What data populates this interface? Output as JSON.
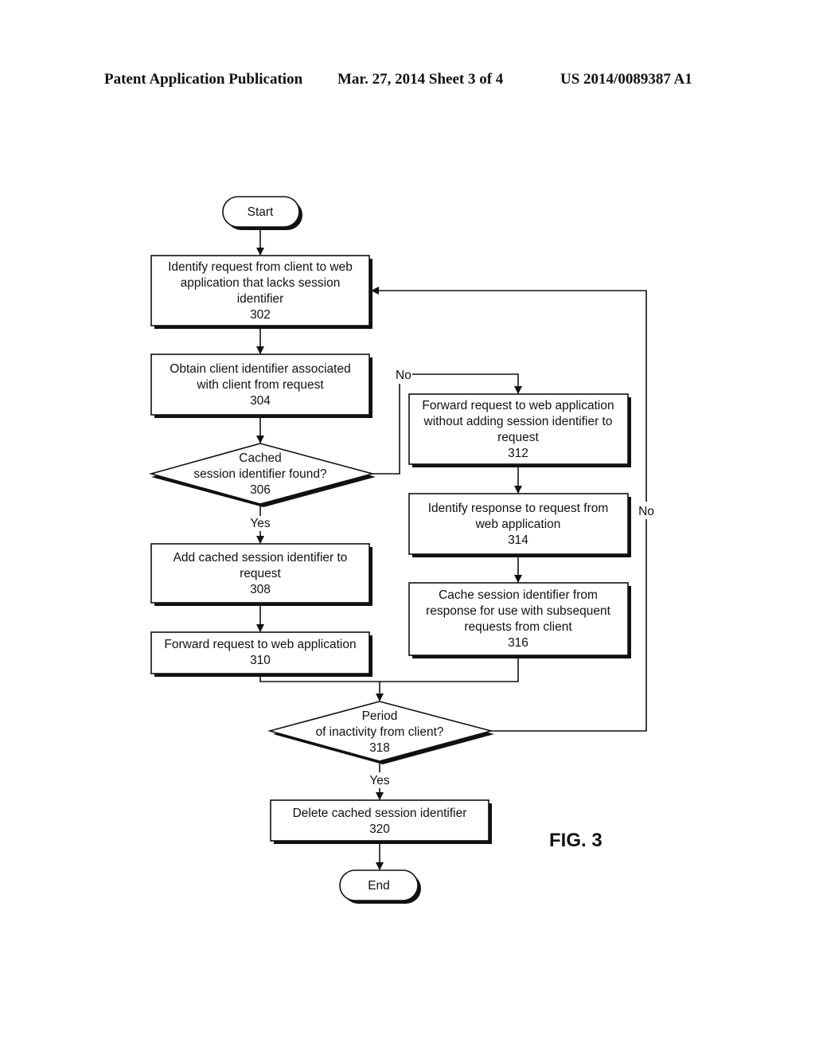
{
  "header": {
    "publication": "Patent Application Publication",
    "date_sheet": "Mar. 27, 2014  Sheet 3 of 4",
    "number": "US 2014/0089387 A1"
  },
  "figure_label": "FIG. 3",
  "nodes": {
    "start": {
      "type": "terminal",
      "lines": [
        "Start"
      ]
    },
    "n302": {
      "type": "process",
      "lines": [
        "Identify request from client to web",
        "application that lacks session",
        "identifier",
        "302"
      ]
    },
    "n304": {
      "type": "process",
      "lines": [
        "Obtain client identifier associated",
        "with client from request",
        "304"
      ]
    },
    "n306": {
      "type": "decision",
      "lines": [
        "Cached",
        "session identifier found?",
        "306"
      ]
    },
    "n308": {
      "type": "process",
      "lines": [
        "Add cached session identifier to",
        "request",
        "308"
      ]
    },
    "n310": {
      "type": "process",
      "lines": [
        "Forward request to web application",
        "310"
      ]
    },
    "n312": {
      "type": "process",
      "lines": [
        "Forward request to web application",
        "without adding session identifier to",
        "request",
        "312"
      ]
    },
    "n314": {
      "type": "process",
      "lines": [
        "Identify response to request from",
        "web application",
        "314"
      ]
    },
    "n316": {
      "type": "process",
      "lines": [
        "Cache session identifier from",
        "response for use with subsequent",
        "requests from client",
        "316"
      ]
    },
    "n318": {
      "type": "decision",
      "lines": [
        "Period",
        "of inactivity from client?",
        "318"
      ]
    },
    "n320": {
      "type": "process",
      "lines": [
        "Delete cached session identifier",
        "320"
      ]
    },
    "end": {
      "type": "terminal",
      "lines": [
        "End"
      ]
    }
  },
  "edge_labels": {
    "e306_yes": "Yes",
    "e306_no": "No",
    "e318_yes": "Yes",
    "e318_no": "No"
  },
  "edges": [
    {
      "from": "start",
      "to": "n302"
    },
    {
      "from": "n302",
      "to": "n304"
    },
    {
      "from": "n304",
      "to": "n306"
    },
    {
      "from": "n306",
      "to": "n308",
      "label": "Yes"
    },
    {
      "from": "n306",
      "to": "n312",
      "label": "No"
    },
    {
      "from": "n308",
      "to": "n310"
    },
    {
      "from": "n312",
      "to": "n314"
    },
    {
      "from": "n314",
      "to": "n316"
    },
    {
      "from": "n310",
      "to": "n318"
    },
    {
      "from": "n316",
      "to": "n318"
    },
    {
      "from": "n318",
      "to": "n320",
      "label": "Yes"
    },
    {
      "from": "n318",
      "to": "n302",
      "label": "No"
    },
    {
      "from": "n320",
      "to": "end"
    }
  ]
}
